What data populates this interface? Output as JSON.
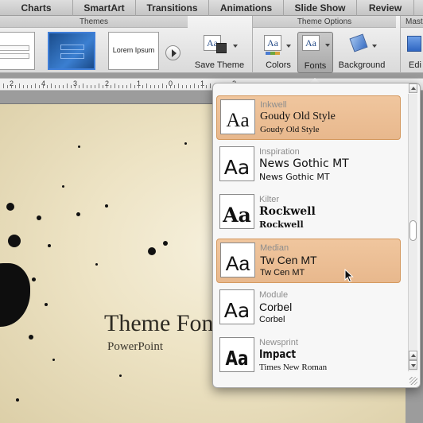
{
  "ribbon": {
    "tabs": [
      {
        "label": "Charts"
      },
      {
        "label": "SmartArt"
      },
      {
        "label": "Transitions"
      },
      {
        "label": "Animations"
      },
      {
        "label": "Slide Show"
      },
      {
        "label": "Review"
      }
    ],
    "groups": {
      "themes": "Themes",
      "theme_options": "Theme Options",
      "master_partial": "Mast"
    },
    "theme_thumb_text": "Lorem Ipsum",
    "buttons": {
      "save_theme": "Save Theme",
      "colors": "Colors",
      "fonts": "Fonts",
      "background": "Background",
      "edit_partial": "Edi"
    }
  },
  "ruler": {
    "labels": [
      "2",
      "4",
      "3",
      "2",
      "1",
      "0",
      "1",
      "2"
    ]
  },
  "slide": {
    "title": "Theme Fonts",
    "subtitle": "PowerPoint"
  },
  "fonts_menu": {
    "items": [
      {
        "name": "Inkwell",
        "heading_font": "Goudy Old Style",
        "body_font": "Goudy Old Style",
        "preview": "Aa",
        "selected": true
      },
      {
        "name": "Inspiration",
        "heading_font": "News Gothic MT",
        "body_font": "News Gothic MT",
        "preview": "Aa",
        "selected": false
      },
      {
        "name": "Kilter",
        "heading_font": "Rockwell",
        "body_font": "Rockwell",
        "preview": "Aa",
        "selected": false
      },
      {
        "name": "Median",
        "heading_font": "Tw Cen MT",
        "body_font": "Tw Cen MT",
        "preview": "Aa",
        "selected": true
      },
      {
        "name": "Module",
        "heading_font": "Corbel",
        "body_font": "Corbel",
        "preview": "Aa",
        "selected": false
      },
      {
        "name": "Newsprint",
        "heading_font": "Impact",
        "body_font": "Times New Roman",
        "preview": "Aa",
        "selected": false
      }
    ]
  },
  "colors": {
    "selection_fill": "#eabb90",
    "selection_border": "#d4995f",
    "ribbon_blue": "#3f7ed8"
  },
  "icons": {
    "theme_nav": "chevron-right-icon",
    "save_theme": "save-theme-icon",
    "colors": "theme-colors-icon",
    "fonts": "theme-fonts-icon",
    "background": "background-icon",
    "pointer": "mouse-pointer-icon"
  }
}
